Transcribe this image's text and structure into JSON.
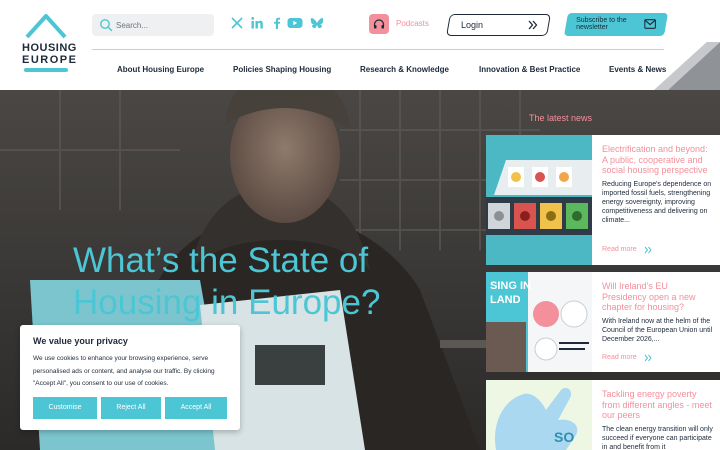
{
  "logo": {
    "line1": "HOUSING",
    "line2": "EUROPE"
  },
  "search": {
    "placeholder": "Search..."
  },
  "social": [
    "x-icon",
    "linkedin-icon",
    "facebook-icon",
    "youtube-icon",
    "bluesky-icon"
  ],
  "podcasts": {
    "label": "Podcasts"
  },
  "login": {
    "label": "Login"
  },
  "subscribe": {
    "label": "Subscribe to the newsletter"
  },
  "nav": [
    "About Housing Europe",
    "Policies Shaping Housing",
    "Research & Knowledge",
    "Innovation & Best Practice",
    "Events & News"
  ],
  "hero": {
    "title": "What’s the State of Housing in Europe?"
  },
  "news": {
    "heading": "The latest news",
    "items": [
      {
        "title": "Electrification and beyond: A public, cooperative and social housing perspective",
        "text": "Reducing Europe's dependence on imported fossil fuels, strengthening energy sovereignty, improving competitiveness and delivering on climate...",
        "more": "Read more"
      },
      {
        "title": "Will Ireland’s EU Presidency open a new chapter for housing?",
        "text": "With Ireland now at the helm of the Council of the European Union until December 2026,...",
        "more": "Read more"
      },
      {
        "title": "Tackling energy poverty from different angles - meet our peers",
        "text": "The clean energy transition will only succeed if everyone can participate in and benefit from it",
        "more": ""
      }
    ],
    "image_text": {
      "ireland": "SING IN\nLAND"
    }
  },
  "cookie": {
    "title": "We value your privacy",
    "text": "We use cookies to enhance your browsing experience, serve personalised ads or content, and analyse our traffic. By clicking \"Accept All\", you consent to our use of cookies.",
    "customise": "Customise",
    "reject": "Reject All",
    "accept": "Accept All"
  },
  "colors": {
    "accent": "#4cc6d4",
    "pink": "#f48f9c",
    "navy": "#1e2a3a",
    "grey_corner": "#8f9296"
  }
}
